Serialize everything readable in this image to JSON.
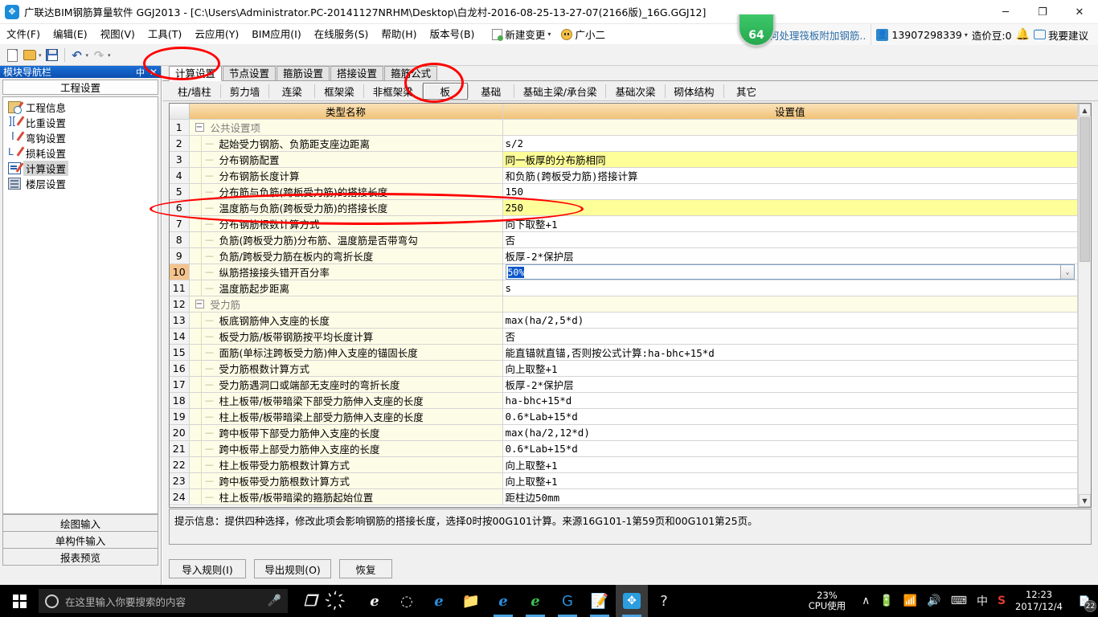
{
  "window": {
    "title": "广联达BIM钢筋算量软件 GGJ2013 - [C:\\Users\\Administrator.PC-20141127NRHM\\Desktop\\白龙村-2016-08-25-13-27-07(2166版)_16G.GGJ12]",
    "logo_glyph": "✥",
    "minimize": "─",
    "maximize": "❐",
    "close": "✕",
    "badge_count": "64"
  },
  "menu": {
    "items": [
      "文件(F)",
      "编辑(E)",
      "视图(V)",
      "工具(T)",
      "云应用(Y)",
      "BIM应用(I)",
      "在线服务(S)",
      "帮助(H)",
      "版本号(B)"
    ],
    "new_change": "新建变更",
    "new_change_caret": "▾",
    "assistant": "广小二",
    "ad_link": "如何处理筏板附加钢筋..",
    "phone": "13907298339",
    "phone_caret": "▾",
    "beans": "造价豆:0",
    "bell": "🔔",
    "suggestion": "我要建议"
  },
  "toolbar": {
    "new_label": "新建",
    "open_label": "打开",
    "save_label": "保存",
    "undo_label": "撤销",
    "redo_label": "恢复",
    "caret": "▾",
    "undo_glyph": "↶",
    "redo_glyph": "↷"
  },
  "sidebar": {
    "title": "模块导航栏",
    "pin": "中",
    "close": "✕",
    "section": "工程设置",
    "items": [
      {
        "label": "工程信息",
        "icon": "project-info-icon",
        "selected": false
      },
      {
        "label": "比重设置",
        "icon": "weight-settings-icon",
        "selected": false
      },
      {
        "label": "弯钩设置",
        "icon": "hook-settings-icon",
        "selected": false
      },
      {
        "label": "损耗设置",
        "icon": "loss-settings-icon",
        "selected": false
      },
      {
        "label": "计算设置",
        "icon": "calc-settings-icon",
        "selected": true
      },
      {
        "label": "楼层设置",
        "icon": "floor-settings-icon",
        "selected": false
      }
    ],
    "buttons": [
      "绘图输入",
      "单构件输入",
      "报表预览"
    ]
  },
  "tabs_primary": [
    {
      "label": "计算设置",
      "active": true
    },
    {
      "label": "节点设置",
      "active": false
    },
    {
      "label": "箍筋设置",
      "active": false
    },
    {
      "label": "搭接设置",
      "active": false
    },
    {
      "label": "箍筋公式",
      "active": false
    }
  ],
  "tabs_secondary": [
    {
      "label": "柱/墙柱",
      "active": false
    },
    {
      "label": "剪力墙",
      "active": false
    },
    {
      "label": "连梁",
      "active": false
    },
    {
      "label": "框架梁",
      "active": false
    },
    {
      "label": "非框架梁",
      "active": false
    },
    {
      "label": "板",
      "active": true
    },
    {
      "label": "基础",
      "active": false
    },
    {
      "label": "基础主梁/承台梁",
      "active": false
    },
    {
      "label": "基础次梁",
      "active": false
    },
    {
      "label": "砌体结构",
      "active": false
    },
    {
      "label": "其它",
      "active": false
    }
  ],
  "grid": {
    "headers": {
      "index": "",
      "name": "类型名称",
      "value": "设置值"
    },
    "rows": [
      {
        "no": "1",
        "name": "公共设置项",
        "value": "",
        "kind": "group",
        "highlight": false,
        "current": false
      },
      {
        "no": "2",
        "name": "起始受力钢筋、负筋距支座边距离",
        "value": "s/2",
        "kind": "item",
        "highlight": false,
        "current": false
      },
      {
        "no": "3",
        "name": "分布钢筋配置",
        "value": "同一板厚的分布筋相同",
        "kind": "item",
        "highlight": true,
        "current": false,
        "cn_value": true
      },
      {
        "no": "4",
        "name": "分布钢筋长度计算",
        "value": "和负筋(跨板受力筋)搭接计算",
        "kind": "item",
        "highlight": false,
        "current": false,
        "cn_value": true
      },
      {
        "no": "5",
        "name": "分布筋与负筋(跨板受力筋)的搭接长度",
        "value": "150",
        "kind": "item",
        "highlight": false,
        "current": false
      },
      {
        "no": "6",
        "name": "温度筋与负筋(跨板受力筋)的搭接长度",
        "value": "250",
        "kind": "item",
        "highlight": true,
        "current": false
      },
      {
        "no": "7",
        "name": "分布钢筋根数计算方式",
        "value": "向下取整+1",
        "kind": "item",
        "highlight": false,
        "current": false,
        "cn_value": true
      },
      {
        "no": "8",
        "name": "负筋(跨板受力筋)分布筋、温度筋是否带弯勾",
        "value": "否",
        "kind": "item",
        "highlight": false,
        "current": false,
        "cn_value": true
      },
      {
        "no": "9",
        "name": "负筋/跨板受力筋在板内的弯折长度",
        "value": "板厚-2*保护层",
        "kind": "item",
        "highlight": false,
        "current": false,
        "cn_value": true
      },
      {
        "no": "10",
        "name": "纵筋搭接接头错开百分率",
        "value": "50%",
        "kind": "editing",
        "highlight": false,
        "current": true
      },
      {
        "no": "11",
        "name": "温度筋起步距离",
        "value": "s",
        "kind": "item",
        "highlight": false,
        "current": false
      },
      {
        "no": "12",
        "name": "受力筋",
        "value": "",
        "kind": "group",
        "highlight": false,
        "current": false
      },
      {
        "no": "13",
        "name": "板底钢筋伸入支座的长度",
        "value": "max(ha/2,5*d)",
        "kind": "item",
        "highlight": false,
        "current": false
      },
      {
        "no": "14",
        "name": "板受力筋/板带钢筋按平均长度计算",
        "value": "否",
        "kind": "item",
        "highlight": false,
        "current": false,
        "cn_value": true
      },
      {
        "no": "15",
        "name": "面筋(单标注跨板受力筋)伸入支座的锚固长度",
        "value": "能直锚就直锚,否则按公式计算:ha-bhc+15*d",
        "kind": "item",
        "highlight": false,
        "current": false,
        "cn_value": true
      },
      {
        "no": "16",
        "name": "受力筋根数计算方式",
        "value": "向上取整+1",
        "kind": "item",
        "highlight": false,
        "current": false,
        "cn_value": true
      },
      {
        "no": "17",
        "name": "受力筋遇洞口或端部无支座时的弯折长度",
        "value": "板厚-2*保护层",
        "kind": "item",
        "highlight": false,
        "current": false,
        "cn_value": true
      },
      {
        "no": "18",
        "name": "柱上板带/板带暗梁下部受力筋伸入支座的长度",
        "value": "ha-bhc+15*d",
        "kind": "item",
        "highlight": false,
        "current": false
      },
      {
        "no": "19",
        "name": "柱上板带/板带暗梁上部受力筋伸入支座的长度",
        "value": "0.6*Lab+15*d",
        "kind": "item",
        "highlight": false,
        "current": false
      },
      {
        "no": "20",
        "name": "跨中板带下部受力筋伸入支座的长度",
        "value": "max(ha/2,12*d)",
        "kind": "item",
        "highlight": false,
        "current": false
      },
      {
        "no": "21",
        "name": "跨中板带上部受力筋伸入支座的长度",
        "value": "0.6*Lab+15*d",
        "kind": "item",
        "highlight": false,
        "current": false
      },
      {
        "no": "22",
        "name": "柱上板带受力筋根数计算方式",
        "value": "向上取整+1",
        "kind": "item",
        "highlight": false,
        "current": false,
        "cn_value": true
      },
      {
        "no": "23",
        "name": "跨中板带受力筋根数计算方式",
        "value": "向上取整+1",
        "kind": "item",
        "highlight": false,
        "current": false,
        "cn_value": true
      },
      {
        "no": "24",
        "name": "柱上板带/板带暗梁的箍筋起始位置",
        "value": "距柱边50mm",
        "kind": "item",
        "highlight": false,
        "current": false,
        "cn_value": true
      }
    ],
    "scroll_up": "▲",
    "scroll_down": "▼",
    "combo_caret": "⌄"
  },
  "tip": {
    "text": "提示信息：提供四种选择，修改此项会影响钢筋的搭接长度，选择0时按00G101计算。来源16G101-1第59页和00G101第25页。"
  },
  "actions": {
    "import": "导入规则(I)",
    "export": "导出规则(O)",
    "restore": "恢复"
  },
  "taskbar": {
    "search_placeholder": "在这里输入你要搜索的内容",
    "mic": "🎤",
    "cpu_percent": "23%",
    "cpu_label": "CPU使用",
    "tray_caret": "∧",
    "tray_battery": "🔋",
    "tray_wifi": "📶",
    "tray_volume": "🔊",
    "tray_keyboard": "⌨",
    "tray_ime": "中",
    "tray_sogou": "S",
    "time": "12:23",
    "date": "2017/12/4",
    "notif_count": "22",
    "apps": [
      {
        "name": "task-view-icon",
        "glyph": "❐",
        "running": false,
        "active": false
      },
      {
        "name": "app-swirl-icon",
        "glyph": "҉",
        "running": false,
        "active": false
      },
      {
        "name": "app-ie-classic-icon",
        "glyph": "e",
        "running": false,
        "active": false
      },
      {
        "name": "app-spiral-icon",
        "glyph": "◌",
        "running": false,
        "active": false
      },
      {
        "name": "app-edge-icon",
        "glyph": "e",
        "running": false,
        "active": false
      },
      {
        "name": "app-explorer-icon",
        "glyph": "📁",
        "running": false,
        "active": false
      },
      {
        "name": "app-ie-icon",
        "glyph": "e",
        "running": true,
        "active": false
      },
      {
        "name": "app-360-icon",
        "glyph": "e",
        "running": true,
        "active": false
      },
      {
        "name": "app-browser-g-icon",
        "glyph": "G",
        "running": true,
        "active": false
      },
      {
        "name": "app-notes-icon",
        "glyph": "📝",
        "running": true,
        "active": false
      },
      {
        "name": "app-ggj-icon",
        "glyph": "✥",
        "running": true,
        "active": true
      },
      {
        "name": "app-help-icon",
        "glyph": "?",
        "running": false,
        "active": false
      }
    ]
  },
  "colors": {
    "grid_header": "#f0c277",
    "grid_header_text": "#7a1010",
    "highlight_row": "#ffff99",
    "name_cell": "#fdfde7",
    "current_index": "#f5c38d",
    "selection": "#0a56c8",
    "annotation": "#ff0000",
    "title_bar_nav": "#0a4fae",
    "accent": "#2f87c9"
  }
}
